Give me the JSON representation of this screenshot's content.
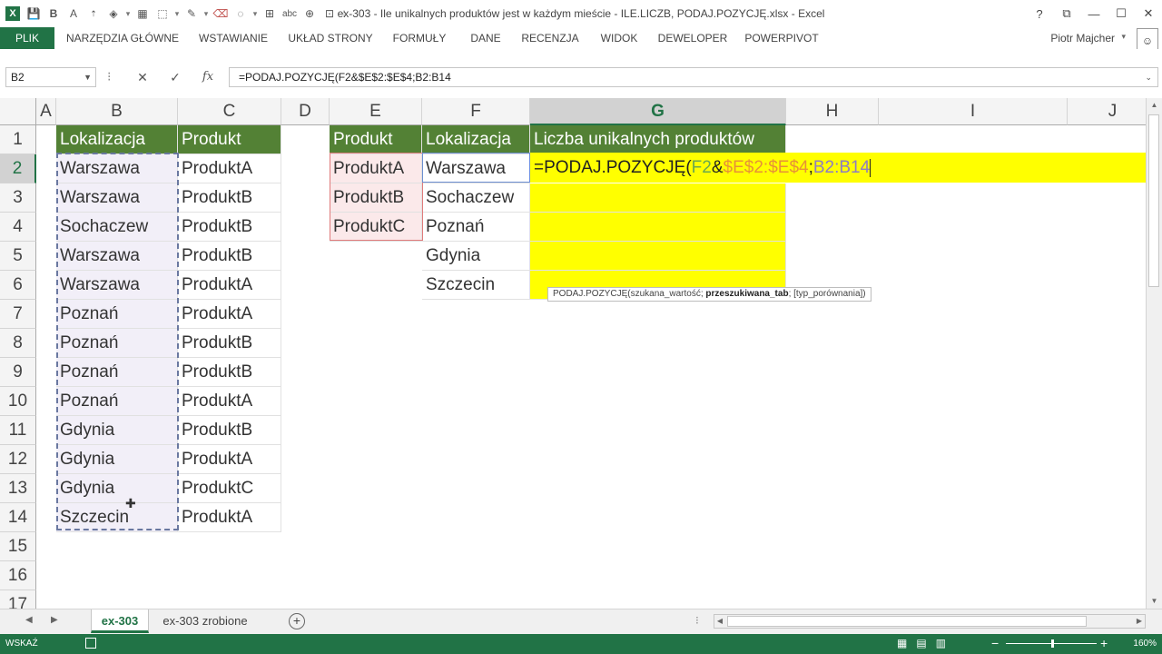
{
  "window": {
    "title": "ex-303 - Ile unikalnych produktów jest w każdym mieście - ILE.LICZB, PODAJ.POZYCJĘ.xlsx - Excel",
    "controls": [
      "?",
      "⧉",
      "—",
      "☐",
      "✕"
    ]
  },
  "qat": {
    "bold_label": "B",
    "format_label": "A",
    "abc_label": "abc"
  },
  "ribbon": {
    "tabs": [
      "PLIK",
      "NARZĘDZIA GŁÓWNE",
      "WSTAWIANIE",
      "UKŁAD STRONY",
      "FORMUŁY",
      "DANE",
      "RECENZJA",
      "WIDOK",
      "DEWELOPER",
      "POWERPIVOT"
    ],
    "user": "Piotr Majcher"
  },
  "formula_bar": {
    "name_box": "B2",
    "cancel": "✕",
    "enter": "✓",
    "fx": "fx",
    "formula": "=PODAJ.POZYCJĘ(F2&$E$2:$E$4;B2:B14"
  },
  "grid": {
    "columns": [
      "A",
      "B",
      "C",
      "D",
      "E",
      "F",
      "G",
      "H",
      "I",
      "J"
    ],
    "rows": [
      "1",
      "2",
      "3",
      "4",
      "5",
      "6",
      "7",
      "8",
      "9",
      "10",
      "11",
      "12",
      "13",
      "14",
      "15",
      "16",
      "17"
    ],
    "headers": {
      "B": "Lokalizacja",
      "C": "Produkt",
      "E": "Produkt",
      "F": "Lokalizacja",
      "G": "Liczba unikalnych produktów"
    },
    "colB": [
      "Warszawa",
      "Warszawa",
      "Sochaczew",
      "Warszawa",
      "Warszawa",
      "Poznań",
      "Poznań",
      "Poznań",
      "Poznań",
      "Gdynia",
      "Gdynia",
      "Gdynia",
      "Szczecin"
    ],
    "colC": [
      "ProduktA",
      "ProduktB",
      "ProduktB",
      "ProduktB",
      "ProduktA",
      "ProduktA",
      "ProduktB",
      "ProduktB",
      "ProduktA",
      "ProduktB",
      "ProduktA",
      "ProduktC",
      "ProduktA"
    ],
    "colE": [
      "ProduktA",
      "ProduktB",
      "ProduktC"
    ],
    "colF": [
      "Warszawa",
      "Sochaczew",
      "Poznań",
      "Gdynia",
      "Szczecin"
    ]
  },
  "edit_cell": {
    "part1": "=PODAJ.POZYCJĘ(",
    "part2": "F2",
    "part3": "&",
    "part4": "$E$2:$E$4",
    "part5": ";",
    "part6": "B2:B14"
  },
  "tooltip": {
    "fn": "PODAJ.POZYCJĘ(",
    "arg1": "szukana_wartość; ",
    "arg2": "przeszukiwana_tab",
    "arg3": "; [typ_porównania])"
  },
  "sheets": [
    "ex-303",
    "ex-303 zrobione"
  ],
  "add_sheet": "+",
  "status": {
    "mode": "WSKAŹ",
    "zoom": "160%"
  },
  "colors": {
    "accent": "#217346",
    "header_fill": "#538135",
    "highlight": "#ffff00"
  }
}
